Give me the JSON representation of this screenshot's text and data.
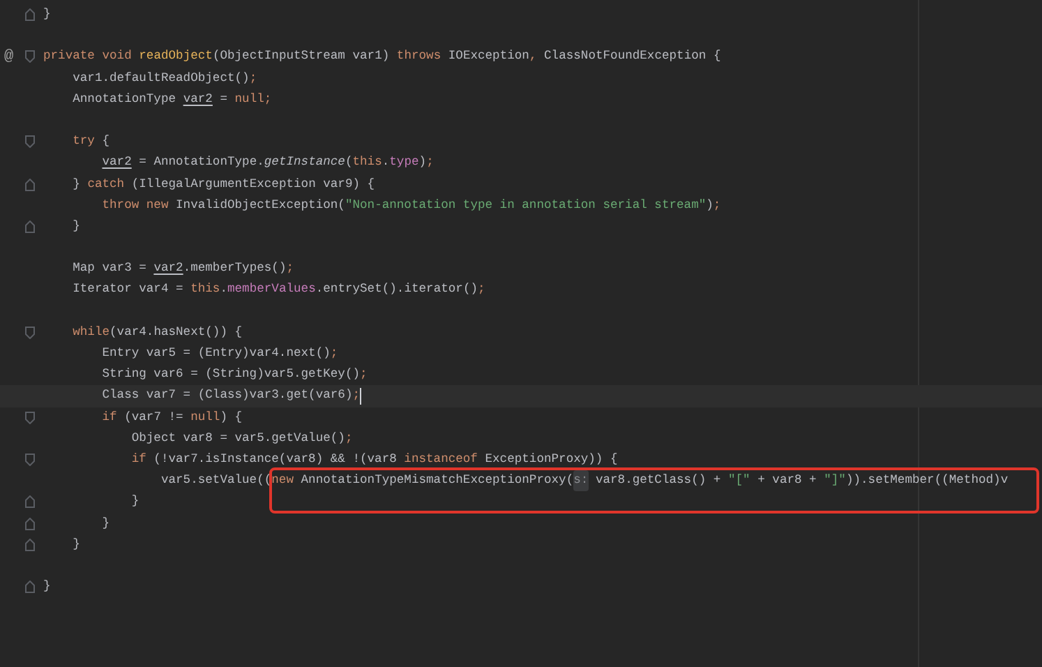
{
  "lines": [
    {
      "kind": "code",
      "fold_end": true,
      "tokens": [
        {
          "text": "}",
          "kind": "plain"
        }
      ]
    },
    {
      "kind": "blank"
    },
    {
      "kind": "code",
      "fold_start": true,
      "marker": "@",
      "tokens": [
        {
          "text": "private void ",
          "kind": "keyword"
        },
        {
          "text": "readObject",
          "kind": "decl"
        },
        {
          "text": "(ObjectInputStream var1) ",
          "kind": "plain"
        },
        {
          "text": "throws",
          "kind": "keyword"
        },
        {
          "text": " IOException",
          "kind": "plain"
        },
        {
          "text": ",",
          "kind": "keyword"
        },
        {
          "text": " ClassNotFoundException {",
          "kind": "plain"
        }
      ]
    },
    {
      "kind": "code",
      "tokens": [
        {
          "text": "    var1.defaultReadObject()",
          "kind": "plain"
        },
        {
          "text": ";",
          "kind": "keyword"
        }
      ]
    },
    {
      "kind": "code",
      "tokens": [
        {
          "text": "    AnnotationType ",
          "kind": "plain"
        },
        {
          "text": "var2",
          "kind": "reassigned"
        },
        {
          "text": " = ",
          "kind": "plain"
        },
        {
          "text": "null;",
          "kind": "keyword"
        }
      ]
    },
    {
      "kind": "blank"
    },
    {
      "kind": "code",
      "fold_start": true,
      "tokens": [
        {
          "text": "    try",
          "kind": "keyword"
        },
        {
          "text": " {",
          "kind": "plain"
        }
      ]
    },
    {
      "kind": "code",
      "tokens": [
        {
          "text": "        var2",
          "kind": "reassigned"
        },
        {
          "text": " = AnnotationType.",
          "kind": "plain"
        },
        {
          "text": "getInstance",
          "kind": "static"
        },
        {
          "text": "(",
          "kind": "plain"
        },
        {
          "text": "this",
          "kind": "keyword"
        },
        {
          "text": ".",
          "kind": "plain"
        },
        {
          "text": "type",
          "kind": "field"
        },
        {
          "text": ")",
          "kind": "plain"
        },
        {
          "text": ";",
          "kind": "keyword"
        }
      ]
    },
    {
      "kind": "code",
      "fold_end": true,
      "tokens": [
        {
          "text": "    } ",
          "kind": "plain"
        },
        {
          "text": "catch",
          "kind": "keyword"
        },
        {
          "text": " (IllegalArgumentException var9) {",
          "kind": "plain"
        }
      ]
    },
    {
      "kind": "code",
      "tokens": [
        {
          "text": "        throw new",
          "kind": "keyword"
        },
        {
          "text": " InvalidObjectException(",
          "kind": "plain"
        },
        {
          "text": "\"Non-annotation type in annotation serial stream\"",
          "kind": "string"
        },
        {
          "text": ")",
          "kind": "plain"
        },
        {
          "text": ";",
          "kind": "keyword"
        }
      ]
    },
    {
      "kind": "code",
      "fold_end": true,
      "tokens": [
        {
          "text": "    }",
          "kind": "plain"
        }
      ]
    },
    {
      "kind": "blank"
    },
    {
      "kind": "code",
      "tokens": [
        {
          "text": "    Map var3 = ",
          "kind": "plain"
        },
        {
          "text": "var2",
          "kind": "reassigned"
        },
        {
          "text": ".memberTypes()",
          "kind": "plain"
        },
        {
          "text": ";",
          "kind": "keyword"
        }
      ]
    },
    {
      "kind": "code",
      "tokens": [
        {
          "text": "    Iterator var4 = ",
          "kind": "plain"
        },
        {
          "text": "this",
          "kind": "keyword"
        },
        {
          "text": ".",
          "kind": "plain"
        },
        {
          "text": "memberValues",
          "kind": "field"
        },
        {
          "text": ".entrySet().iterator()",
          "kind": "plain"
        },
        {
          "text": ";",
          "kind": "keyword"
        }
      ]
    },
    {
      "kind": "blank"
    },
    {
      "kind": "code",
      "fold_start": true,
      "tokens": [
        {
          "text": "    while",
          "kind": "keyword"
        },
        {
          "text": "(var4.hasNext()) {",
          "kind": "plain"
        }
      ]
    },
    {
      "kind": "code",
      "tokens": [
        {
          "text": "        Entry var5 = (Entry)var4.next()",
          "kind": "plain"
        },
        {
          "text": ";",
          "kind": "keyword"
        }
      ]
    },
    {
      "kind": "code",
      "tokens": [
        {
          "text": "        String var6 = (String)var5.getKey()",
          "kind": "plain"
        },
        {
          "text": ";",
          "kind": "keyword"
        }
      ]
    },
    {
      "kind": "code",
      "current": true,
      "tokens": [
        {
          "text": "        Class var7 = (Class)var3.get(var6)",
          "kind": "plain"
        },
        {
          "text": ";",
          "kind": "keyword"
        }
      ]
    },
    {
      "kind": "code",
      "fold_start": true,
      "tokens": [
        {
          "text": "        if",
          "kind": "keyword"
        },
        {
          "text": " (var7 != ",
          "kind": "plain"
        },
        {
          "text": "null",
          "kind": "keyword"
        },
        {
          "text": ") {",
          "kind": "plain"
        }
      ]
    },
    {
      "kind": "code",
      "tokens": [
        {
          "text": "            Object var8 = var5.getValue()",
          "kind": "plain"
        },
        {
          "text": ";",
          "kind": "keyword"
        }
      ]
    },
    {
      "kind": "code",
      "fold_start": true,
      "tokens": [
        {
          "text": "            if",
          "kind": "keyword"
        },
        {
          "text": " (!var7.isInstance(var8) && !(var8 ",
          "kind": "plain"
        },
        {
          "text": "instanceof",
          "kind": "keyword"
        },
        {
          "text": " ExceptionProxy)) {",
          "kind": "plain"
        }
      ]
    },
    {
      "kind": "code",
      "tokens": [
        {
          "text": "                var5.setValue(",
          "kind": "plain"
        }
      ],
      "boxed_tokens": [
        {
          "text": "(",
          "kind": "plain"
        },
        {
          "text": "new",
          "kind": "keyword"
        },
        {
          "text": " AnnotationTypeMismatchExceptionProxy(",
          "kind": "plain"
        },
        {
          "text": "s:",
          "kind": "hint"
        },
        {
          "text": " var8.getClass() + ",
          "kind": "plain"
        },
        {
          "text": "\"[\"",
          "kind": "string"
        },
        {
          "text": " + var8 + ",
          "kind": "plain"
        },
        {
          "text": "\"]\"",
          "kind": "string"
        },
        {
          "text": ")).setMember((Method)v",
          "kind": "plain"
        }
      ]
    },
    {
      "kind": "code",
      "fold_end": true,
      "tokens": [
        {
          "text": "            }",
          "kind": "plain"
        }
      ]
    },
    {
      "kind": "code",
      "fold_end": true,
      "tokens": [
        {
          "text": "        }",
          "kind": "plain"
        }
      ]
    },
    {
      "kind": "code",
      "fold_end": true,
      "tokens": [
        {
          "text": "    }",
          "kind": "plain"
        }
      ]
    },
    {
      "kind": "blank"
    },
    {
      "kind": "code",
      "fold_end": true,
      "tokens": [
        {
          "text": "}",
          "kind": "plain"
        }
      ]
    }
  ]
}
